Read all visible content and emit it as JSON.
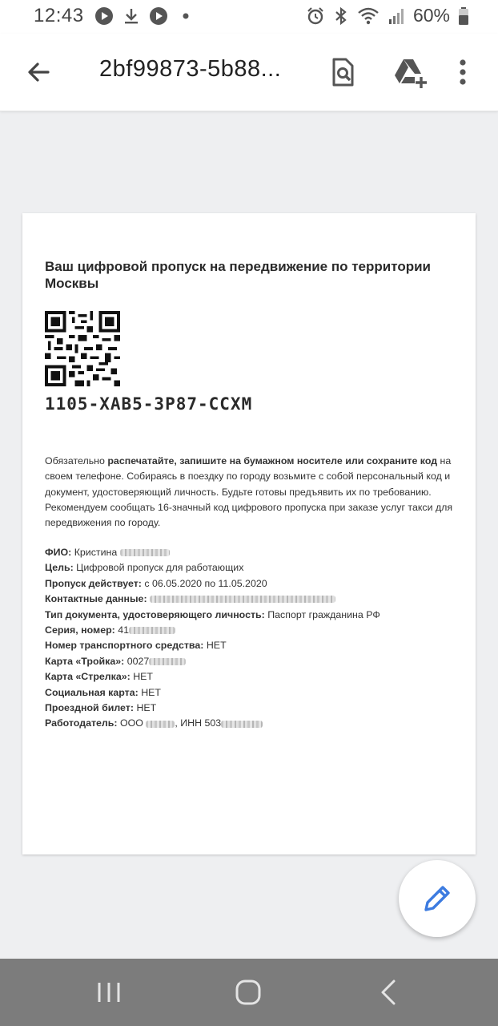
{
  "status_bar": {
    "time": "12:43",
    "left_icons": [
      "play-circle-icon",
      "download-icon",
      "play-circle-icon",
      "dot-icon"
    ],
    "right_icons": [
      "alarm-icon",
      "bluetooth-icon",
      "wifi-icon",
      "signal-icon"
    ],
    "battery_percent": "60%"
  },
  "app_bar": {
    "title": "2bf99873-5b88...",
    "actions": [
      "search-document-icon",
      "drive-add-icon",
      "more-vert-icon"
    ]
  },
  "document": {
    "title": "Ваш цифровой пропуск на передвижение по территории Москвы",
    "pass_code": "1105-XAB5-3P87-CCXM",
    "notice": {
      "p1": "Обязательно ",
      "b1": "распечатайте, запишите на бумажном носителе или сохраните код",
      "p2": " на своем телефоне. Собираясь в поездку по городу возьмите с собой персональный код и документ, удостоверяющий личность. Будьте готовы предъявить их по требованию. Рекомендуем сообщать 16-значный код цифрового пропуска при заказе услуг такси для передвижения по городу."
    },
    "fields": [
      {
        "label": "ФИО:",
        "value": "Кристина"
      },
      {
        "label": "Цель:",
        "value": "Цифровой пропуск для работающих"
      },
      {
        "label": "Пропуск действует:",
        "value": "с 06.05.2020 по 11.05.2020"
      },
      {
        "label": "Контактные данные:",
        "value": ""
      },
      {
        "label": "Тип документа, удостоверяющего личность:",
        "value": "Паспорт гражданина РФ"
      },
      {
        "label": "Серия, номер:",
        "value": "41"
      },
      {
        "label": "Номер транспортного средства:",
        "value": "НЕТ"
      },
      {
        "label": "Карта «Тройка»:",
        "value": "0027"
      },
      {
        "label": "Карта «Стрелка»:",
        "value": "НЕТ"
      },
      {
        "label": "Социальная карта:",
        "value": "НЕТ"
      },
      {
        "label": "Проездной билет:",
        "value": "НЕТ"
      },
      {
        "label": "Работодатель:",
        "value": "ООО",
        "value2": ", ИНН 503"
      }
    ]
  },
  "fab": {
    "icon": "edit-pencil-icon",
    "color": "#3c7be0"
  },
  "nav_bar": {
    "buttons": [
      "recent-apps-icon",
      "home-icon",
      "back-icon"
    ],
    "color": "#7c7c7c"
  }
}
